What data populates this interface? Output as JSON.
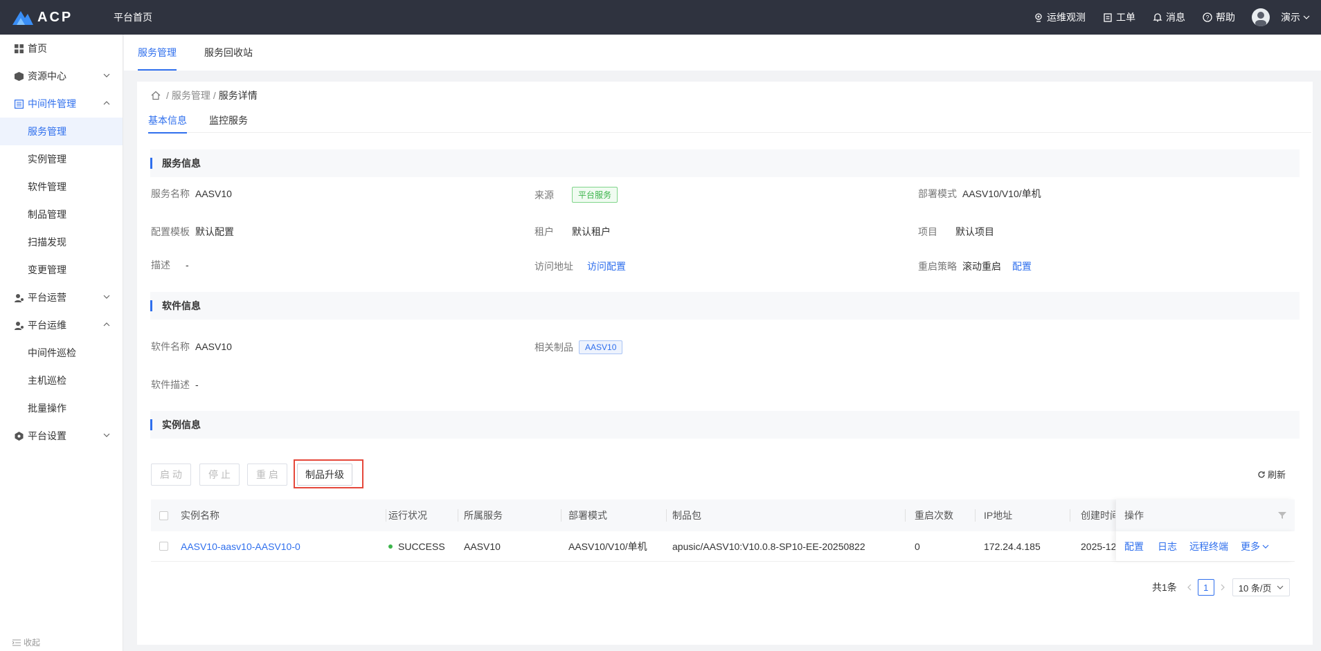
{
  "topbar": {
    "logo_text": "ACP",
    "home_label": "平台首页",
    "items": [
      {
        "label": "运维观测",
        "icon": "observe-icon"
      },
      {
        "label": "工单",
        "icon": "clipboard-icon"
      },
      {
        "label": "消息",
        "icon": "bell-icon"
      },
      {
        "label": "帮助",
        "icon": "help-icon"
      }
    ],
    "user_name": "演示"
  },
  "sidebar": {
    "items": [
      {
        "label": "首页"
      },
      {
        "label": "资源中心"
      },
      {
        "label": "中间件管理"
      },
      {
        "label": "服务管理"
      },
      {
        "label": "实例管理"
      },
      {
        "label": "软件管理"
      },
      {
        "label": "制品管理"
      },
      {
        "label": "扫描发现"
      },
      {
        "label": "变更管理"
      },
      {
        "label": "平台运营"
      },
      {
        "label": "平台运维"
      },
      {
        "label": "中间件巡检"
      },
      {
        "label": "主机巡检"
      },
      {
        "label": "批量操作"
      },
      {
        "label": "平台设置"
      }
    ],
    "collapse_label": "收起"
  },
  "top_tabs": [
    "服务管理",
    "服务回收站"
  ],
  "breadcrumb": {
    "parent": "服务管理",
    "current": "服务详情",
    "sep": "/"
  },
  "sub_tabs": [
    "基本信息",
    "监控服务"
  ],
  "service_info": {
    "title": "服务信息",
    "name_label": "服务名称",
    "name": "AASV10",
    "source_label": "来源",
    "source": "平台服务",
    "deploy_label": "部署模式",
    "deploy": "AASV10/V10/单机",
    "template_label": "配置模板",
    "template": "默认配置",
    "tenant_label": "租户",
    "tenant": "默认租户",
    "project_label": "项目",
    "project": "默认项目",
    "desc_label": "描述",
    "desc": "-",
    "access_label": "访问地址",
    "access": "访问配置",
    "restart_label": "重启策略",
    "restart": "滚动重启",
    "restart_link": "配置"
  },
  "software_info": {
    "title": "软件信息",
    "name_label": "软件名称",
    "name": "AASV10",
    "product_label": "相关制品",
    "product": "AASV10",
    "desc_label": "软件描述",
    "desc": "-"
  },
  "instance_info": {
    "title": "实例信息",
    "buttons": {
      "start": "启 动",
      "stop": "停 止",
      "restart": "重 启",
      "upgrade": "制品升级"
    },
    "refresh": "刷新",
    "columns": [
      "实例名称",
      "运行状况",
      "所属服务",
      "部署模式",
      "制品包",
      "重启次数",
      "IP地址",
      "创建时间",
      "操作"
    ],
    "rows": [
      {
        "name": "AASV10-aasv10-AASV10-0",
        "status": "SUCCESS",
        "service": "AASV10",
        "deploy": "AASV10/V10/单机",
        "package": "apusic/AASV10:V10.0.8-SP10-EE-20250822",
        "restarts": "0",
        "ip": "172.24.4.185",
        "created": "2025-12",
        "actions": [
          "配置",
          "日志",
          "远程终端",
          "更多"
        ]
      }
    ],
    "pager": {
      "total": "共1条",
      "page": "1",
      "size": "10 条/页"
    }
  },
  "colors": {
    "accent": "#2f6fed",
    "topbar": "#2f333f",
    "success": "#3cb44b",
    "highlight": "#e5473a"
  }
}
